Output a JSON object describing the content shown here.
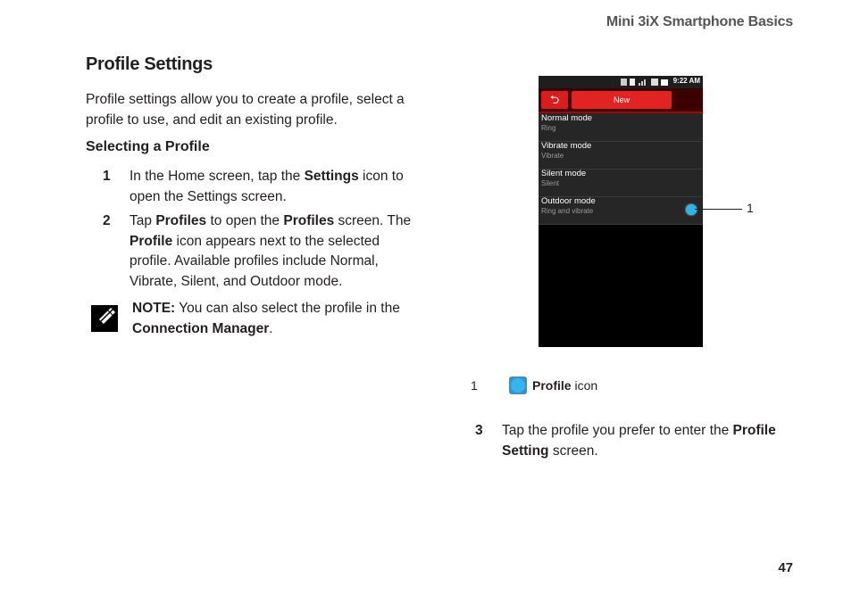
{
  "header": {
    "running_title": "Mini 3iX Smartphone Basics"
  },
  "section": {
    "title": "Profile Settings",
    "intro": "Profile settings allow you to create a profile, select a profile to use, and edit an existing profile.",
    "subheading": "Selecting a Profile"
  },
  "steps": [
    {
      "num": "1",
      "t1": "In the Home screen, tap the ",
      "b1": "Settings",
      "t2": " icon to open the Settings screen."
    },
    {
      "num": "2",
      "t1": "Tap ",
      "b1": "Profiles",
      "t2": " to open the ",
      "b2": "Profiles",
      "t3": " screen. The ",
      "b3": "Profile",
      "t4": " icon appears next to the selected profile. Available profiles include Normal, Vibrate, Silent, and Outdoor mode."
    },
    {
      "num": "3",
      "t1": "Tap the profile you prefer to enter the ",
      "b1": "Profile Setting",
      "t2": " screen."
    }
  ],
  "note": {
    "label": "NOTE:",
    "text": " You can also select the profile in the ",
    "bold": "Connection Manager",
    "end": "."
  },
  "phone": {
    "time": "9:22 AM",
    "back_glyph": "⮌",
    "new_label": "New",
    "items": [
      {
        "title": "Normal mode",
        "subtitle": "Ring"
      },
      {
        "title": "Vibrate mode",
        "subtitle": "Vibrate"
      },
      {
        "title": "Silent mode",
        "subtitle": "Silent"
      },
      {
        "title": "Outdoor mode",
        "subtitle": "Ring and vibrate"
      }
    ]
  },
  "callout": {
    "number": "1"
  },
  "legend": {
    "number": "1",
    "bold": "Profile",
    "text": " icon"
  },
  "footer": {
    "page_number": "47"
  },
  "colors": {
    "accent_red": "#e12323",
    "profile_blue": "#29b5e8"
  }
}
